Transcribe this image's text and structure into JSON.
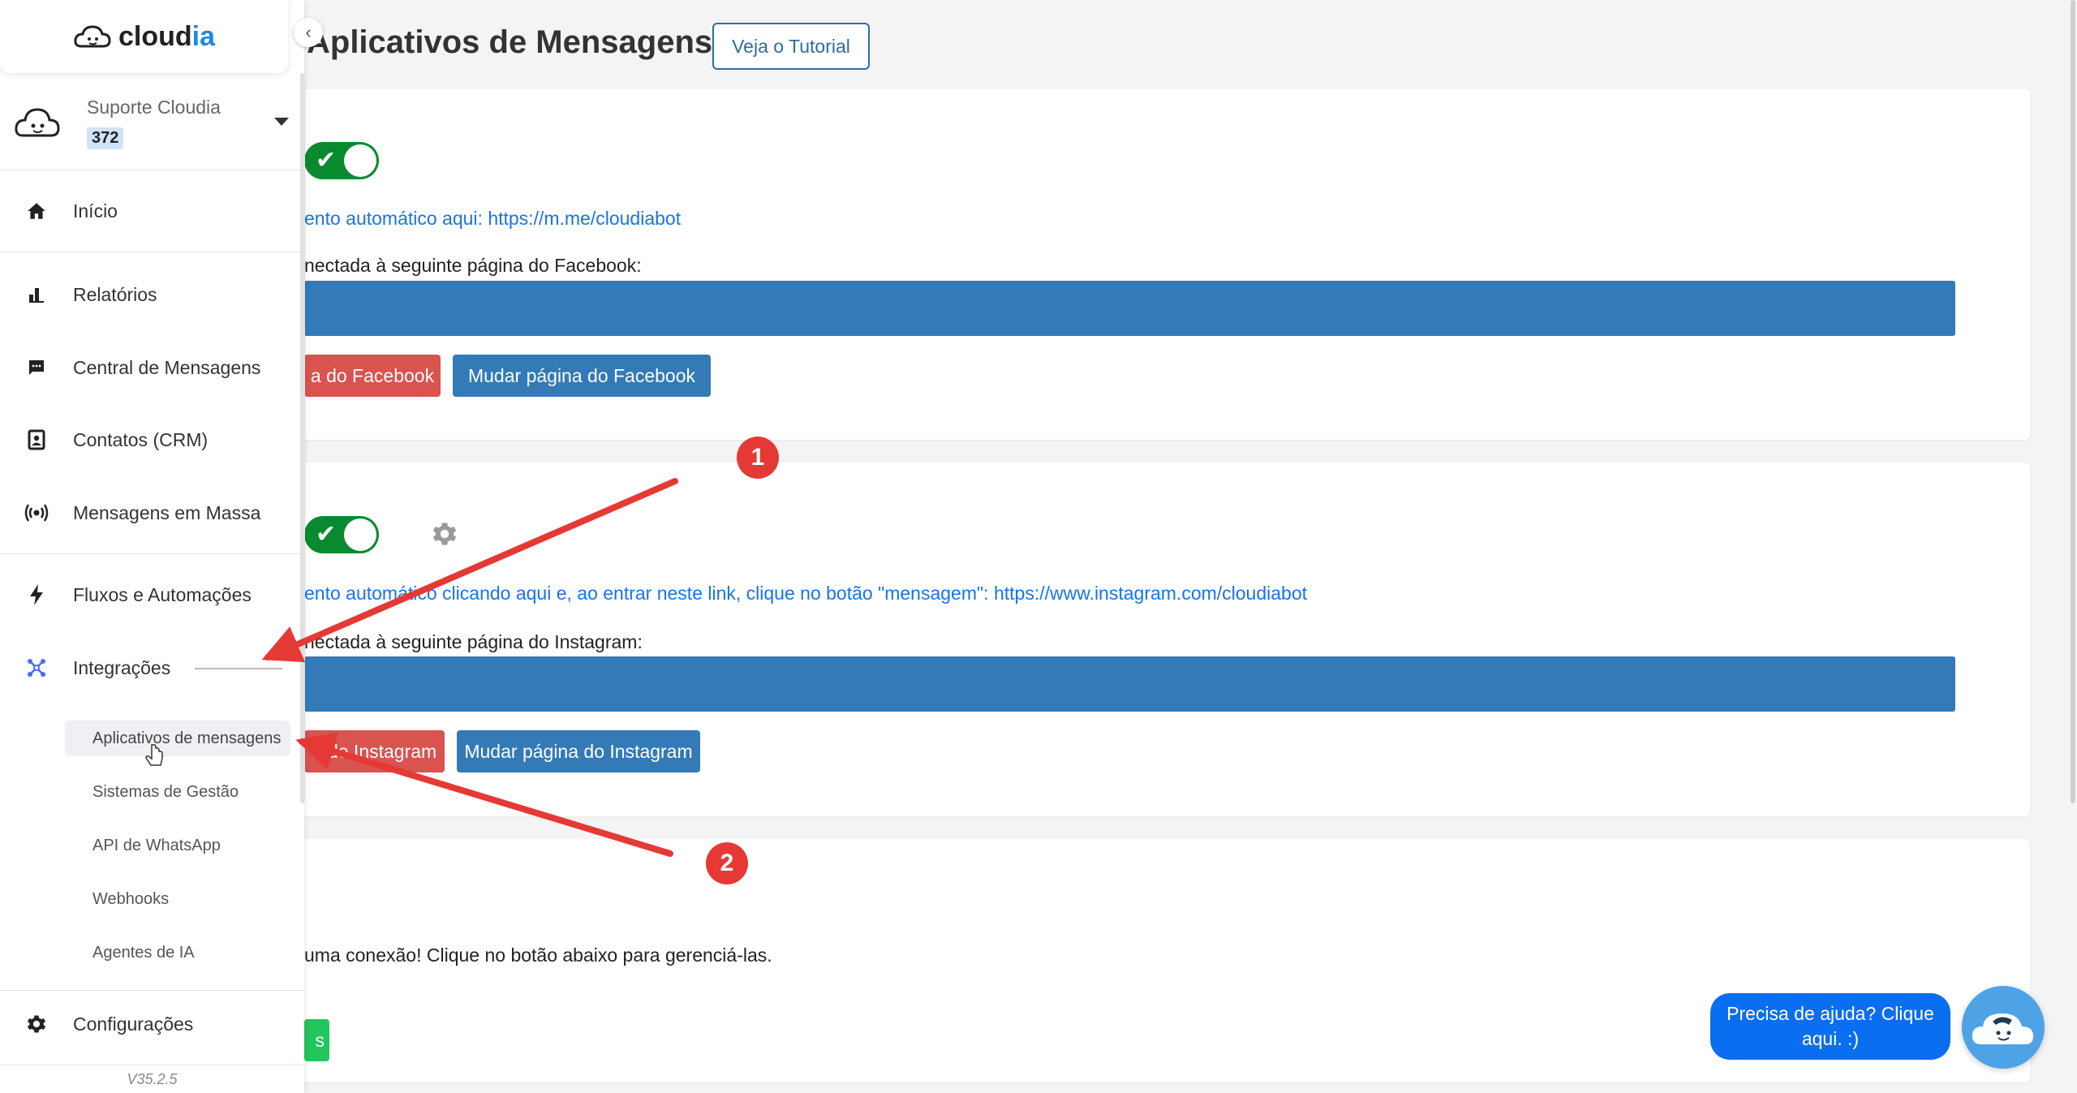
{
  "brand": {
    "name_prefix": "cloud",
    "name_suffix": "ia"
  },
  "account": {
    "name": "Suporte Cloudia",
    "badge": "372"
  },
  "sidebar": {
    "items": [
      {
        "label": "Início",
        "icon": "home-icon"
      },
      {
        "label": "Relatórios",
        "icon": "bar-chart-icon"
      },
      {
        "label": "Central de Mensagens",
        "icon": "chat-icon"
      },
      {
        "label": "Contatos (CRM)",
        "icon": "contact-card-icon"
      },
      {
        "label": "Mensagens em Massa",
        "icon": "broadcast-icon"
      },
      {
        "label": "Fluxos e Automações",
        "icon": "lightning-icon"
      },
      {
        "label": "Integrações",
        "icon": "integrations-icon"
      },
      {
        "label": "Configurações",
        "icon": "gear-icon"
      }
    ],
    "sub_items": [
      {
        "label": "Aplicativos de mensagens",
        "active": true
      },
      {
        "label": "Sistemas de Gestão"
      },
      {
        "label": "API de WhatsApp"
      },
      {
        "label": "Webhooks"
      },
      {
        "label": "Agentes de IA"
      }
    ],
    "version": "V35.2.5"
  },
  "header": {
    "title": "Aplicativos de Mensagens",
    "tutorial_button": "Veja o Tutorial"
  },
  "facebook_card": {
    "link_text": "ento automático aqui: https://m.me/cloudiabot",
    "connected_text": "nectada à seguinte página do Facebook:",
    "disconnect_button": "a do Facebook",
    "change_button": "Mudar página do Facebook"
  },
  "instagram_card": {
    "link_text": "ento automático clicando aqui e, ao entrar neste link, clique no botão \"mensagem\": https://www.instagram.com/cloudiabot",
    "connected_text": "nectada à seguinte página do Instagram:",
    "disconnect_button": "a do Instagram",
    "change_button": "Mudar página do Instagram"
  },
  "third_card": {
    "text": "uma conexão! Clique no botão abaixo para gerenciá-las.",
    "button": "s"
  },
  "help": {
    "bubble": "Precisa de ajuda? Clique aqui. :)"
  },
  "annotations": {
    "one": "1",
    "two": "2"
  },
  "colors": {
    "accent_blue": "#337ab7",
    "toggle_green": "#0a8a2e",
    "danger_red": "#d9534f",
    "link_blue": "#1a73e8",
    "arrow_red": "#e53935"
  }
}
